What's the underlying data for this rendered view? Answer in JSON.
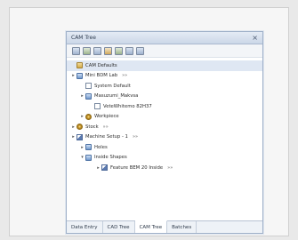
{
  "window": {
    "title": "CAM Tree",
    "close": "×"
  },
  "toolbar": {
    "buttons": [
      "new-icon",
      "open-icon",
      "copy-icon",
      "edit-icon",
      "run-icon",
      "settings-icon",
      "grid-icon"
    ]
  },
  "tree": {
    "rows": [
      {
        "label": "CAM Defaults",
        "expander": "",
        "icon": "folder-icon",
        "arrow": ""
      },
      {
        "label": "Mini BDM Lab",
        "expander": "▸",
        "icon": "blue-icon",
        "arrow": "»»"
      },
      {
        "label": "System Default",
        "expander": "",
        "icon": "doc-icon",
        "arrow": ""
      },
      {
        "label": "Masuzumi_Makvsa",
        "expander": "▸",
        "icon": "blue-icon",
        "arrow": ""
      },
      {
        "label": "VeteWhitemo 82H37",
        "expander": "",
        "icon": "doc-icon",
        "arrow": ""
      },
      {
        "label": "Workpiece",
        "expander": "▸",
        "icon": "gear-icon",
        "arrow": ""
      },
      {
        "label": "Stock",
        "expander": "▸",
        "icon": "gear-icon",
        "arrow": "»»"
      },
      {
        "label": "Machine Setup - 1",
        "expander": "▸",
        "icon": "pen-icon",
        "arrow": "»»"
      },
      {
        "label": "Holes",
        "expander": "▸",
        "icon": "blue-icon",
        "arrow": ""
      },
      {
        "label": "Inside Shapes",
        "expander": "▾",
        "icon": "blue-icon",
        "arrow": ""
      },
      {
        "label": "Feature BEM 20 Inside",
        "expander": "▸",
        "icon": "pen-icon",
        "arrow": "»»"
      }
    ]
  },
  "tabs": [
    {
      "label": "Data Entry"
    },
    {
      "label": "CAD Tree"
    },
    {
      "label": "CAM Tree"
    },
    {
      "label": "Batches"
    }
  ]
}
